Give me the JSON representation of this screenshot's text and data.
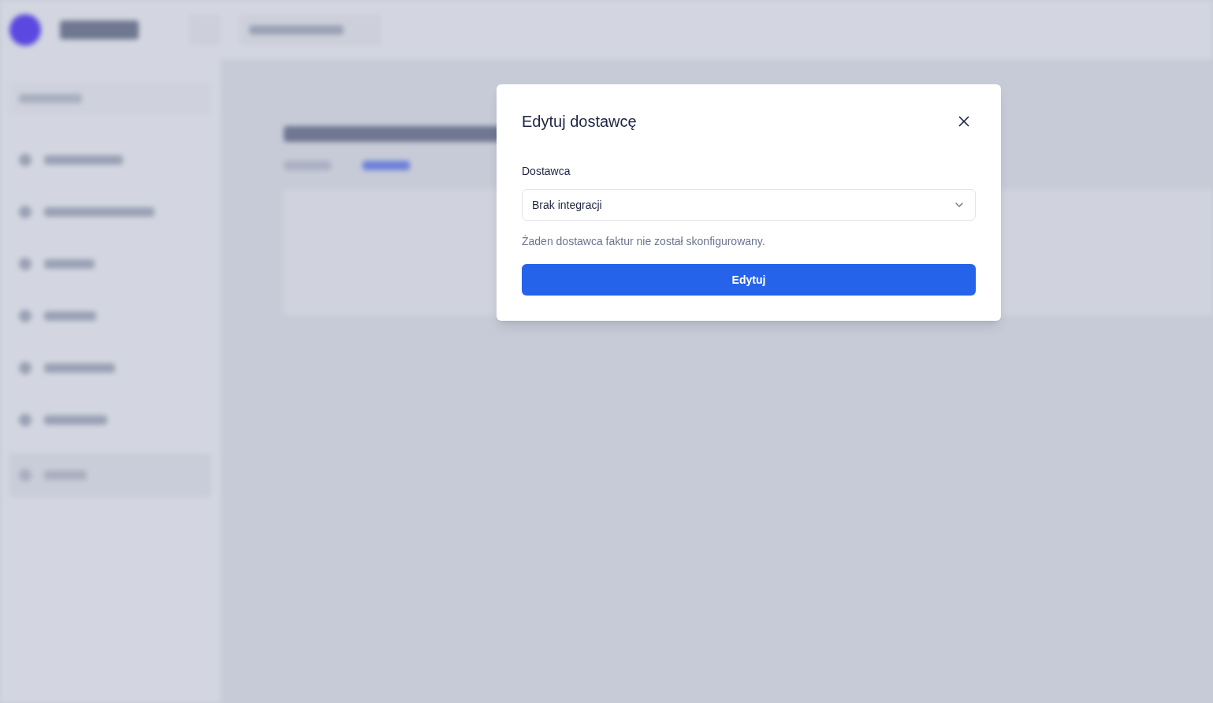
{
  "dialog": {
    "title": "Edytuj dostawcę",
    "field": {
      "label": "Dostawca",
      "value": "Brak integracji"
    },
    "note": "Żaden dostawca faktur nie został skonfigurowany.",
    "submit": "Edytuj"
  }
}
